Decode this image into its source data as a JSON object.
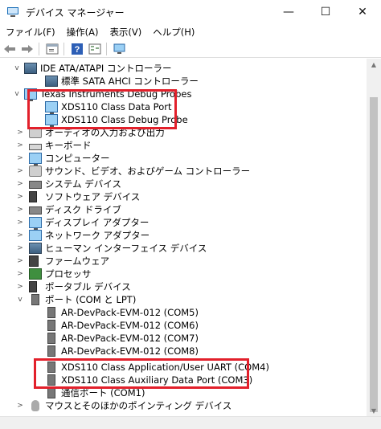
{
  "window": {
    "title": "デバイス マネージャー",
    "minimize": "—",
    "maximize": "☐",
    "close": "✕"
  },
  "menu": [
    "ファイル(F)",
    "操作(A)",
    "表示(V)",
    "ヘルプ(H)"
  ],
  "tree": [
    {
      "label": "IDE ATA/ATAPI コントローラー",
      "level": 1,
      "expander": "v",
      "icon": "ide-controller-icon"
    },
    {
      "label": "標準 SATA AHCI コントローラー",
      "level": 2,
      "expander": "",
      "icon": "ide-controller-icon"
    },
    {
      "label": "Texas Instruments Debug Probes",
      "level": 1,
      "expander": "v",
      "icon": "debug-probe-icon"
    },
    {
      "label": "XDS110 Class Data Port",
      "level": 2,
      "expander": "",
      "icon": "debug-probe-icon"
    },
    {
      "label": "XDS110 Class Debug Probe",
      "level": 2,
      "expander": "",
      "icon": "debug-probe-icon"
    },
    {
      "label": "オーディオの入力および出力",
      "level": 1,
      "expander": ">",
      "icon": "audio-icon"
    },
    {
      "label": "キーボード",
      "level": 1,
      "expander": ">",
      "icon": "keyboard-icon"
    },
    {
      "label": "コンピューター",
      "level": 1,
      "expander": ">",
      "icon": "computer-icon"
    },
    {
      "label": "サウンド、ビデオ、およびゲーム コントローラー",
      "level": 1,
      "expander": ">",
      "icon": "sound-icon"
    },
    {
      "label": "システム デバイス",
      "level": 1,
      "expander": ">",
      "icon": "system-device-icon"
    },
    {
      "label": "ソフトウェア デバイス",
      "level": 1,
      "expander": ">",
      "icon": "software-device-icon"
    },
    {
      "label": "ディスク ドライブ",
      "level": 1,
      "expander": ">",
      "icon": "disk-drive-icon"
    },
    {
      "label": "ディスプレイ アダプター",
      "level": 1,
      "expander": ">",
      "icon": "display-adapter-icon"
    },
    {
      "label": "ネットワーク アダプター",
      "level": 1,
      "expander": ">",
      "icon": "network-adapter-icon"
    },
    {
      "label": "ヒューマン インターフェイス デバイス",
      "level": 1,
      "expander": ">",
      "icon": "hid-icon"
    },
    {
      "label": "ファームウェア",
      "level": 1,
      "expander": ">",
      "icon": "firmware-icon"
    },
    {
      "label": "プロセッサ",
      "level": 1,
      "expander": ">",
      "icon": "processor-icon"
    },
    {
      "label": "ポータブル デバイス",
      "level": 1,
      "expander": ">",
      "icon": "portable-device-icon"
    },
    {
      "label": "ポート (COM と LPT)",
      "level": 1,
      "expander": "v",
      "icon": "port-icon"
    },
    {
      "label": "AR-DevPack-EVM-012 (COM5)",
      "level": 2,
      "expander": "",
      "icon": "port-icon"
    },
    {
      "label": "AR-DevPack-EVM-012 (COM6)",
      "level": 2,
      "expander": "",
      "icon": "port-icon"
    },
    {
      "label": "AR-DevPack-EVM-012 (COM7)",
      "level": 2,
      "expander": "",
      "icon": "port-icon"
    },
    {
      "label": "AR-DevPack-EVM-012 (COM8)",
      "level": 2,
      "expander": "",
      "icon": "port-icon"
    },
    {
      "label": "XDS110 Class Application/User UART (COM4)",
      "level": 2,
      "expander": "",
      "icon": "port-icon"
    },
    {
      "label": "XDS110 Class Auxiliary Data Port (COM3)",
      "level": 2,
      "expander": "",
      "icon": "port-icon"
    },
    {
      "label": "通信ポート (COM1)",
      "level": 2,
      "expander": "",
      "icon": "port-icon"
    },
    {
      "label": "マウスとそのほかのポインティング デバイス",
      "level": 1,
      "expander": ">",
      "icon": "mouse-icon"
    }
  ],
  "colors": {
    "highlight_box": "#e2202b"
  }
}
